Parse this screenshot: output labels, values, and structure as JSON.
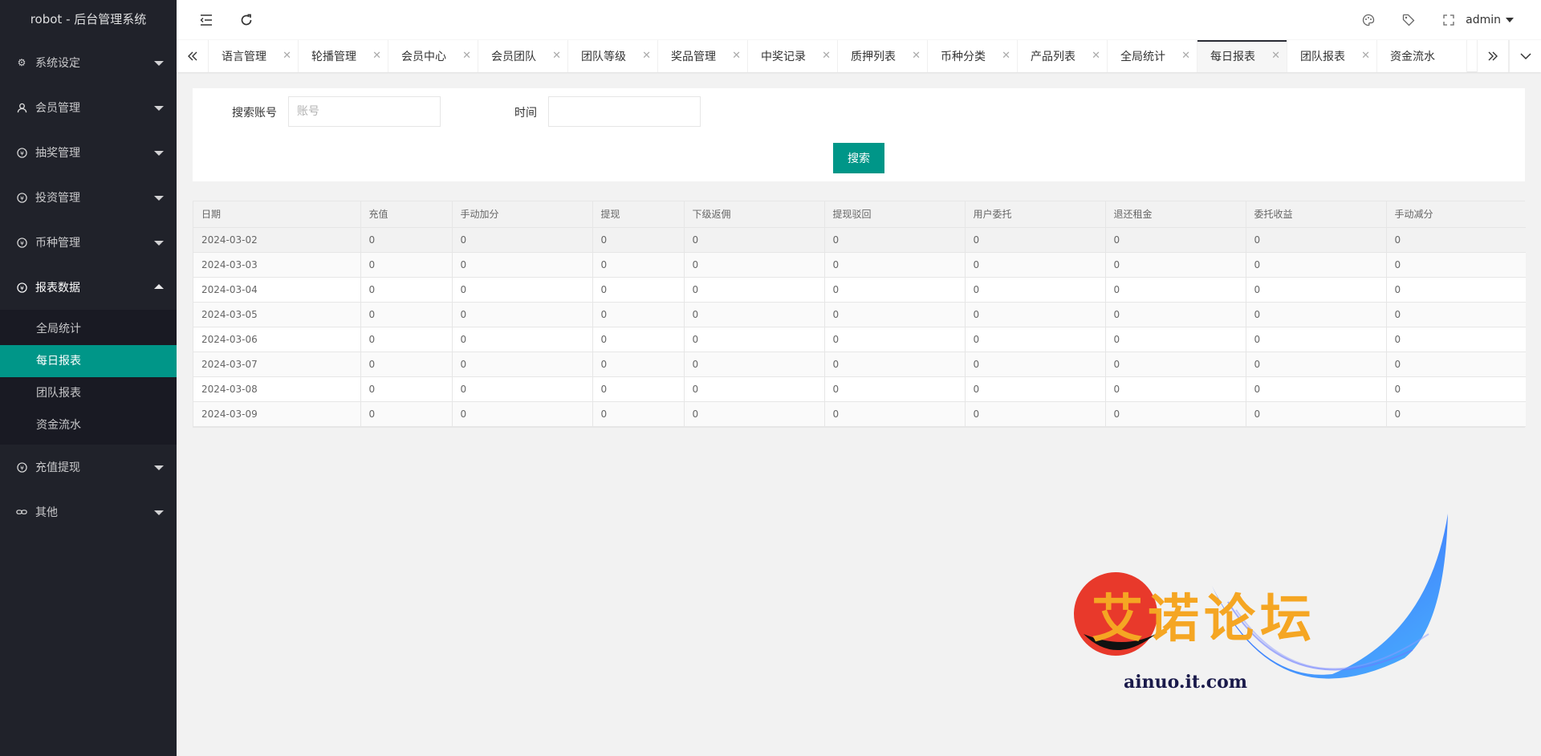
{
  "app": {
    "title": "robot - 后台管理系统"
  },
  "sidebar": {
    "items": [
      {
        "label": "系统设定",
        "icon": "gear-icon"
      },
      {
        "label": "会员管理",
        "icon": "user-icon"
      },
      {
        "label": "抽奖管理",
        "icon": "yen-icon"
      },
      {
        "label": "投资管理",
        "icon": "yen-icon"
      },
      {
        "label": "币种管理",
        "icon": "yen-icon"
      },
      {
        "label": "报表数据",
        "icon": "yen-icon"
      },
      {
        "label": "充值提现",
        "icon": "yen-icon"
      },
      {
        "label": "其他",
        "icon": "link-icon"
      }
    ],
    "report_submenu": [
      "全局统计",
      "每日报表",
      "团队报表",
      "资金流水"
    ]
  },
  "header": {
    "user": "admin"
  },
  "tabs": [
    "语言管理",
    "轮播管理",
    "会员中心",
    "会员团队",
    "团队等级",
    "奖品管理",
    "中奖记录",
    "质押列表",
    "币种分类",
    "产品列表",
    "全局统计",
    "每日报表",
    "团队报表",
    "资金流水"
  ],
  "search": {
    "account_label": "搜索账号",
    "account_placeholder": "账号",
    "account_value": "",
    "time_label": "时间",
    "time_value": "",
    "button": "搜索"
  },
  "table": {
    "columns": [
      "日期",
      "充值",
      "手动加分",
      "提现",
      "下级返佣",
      "提现驳回",
      "用户委托",
      "退还租金",
      "委托收益",
      "手动减分"
    ],
    "rows": [
      [
        "2024-03-02",
        "0",
        "0",
        "0",
        "0",
        "0",
        "0",
        "0",
        "0",
        "0"
      ],
      [
        "2024-03-03",
        "0",
        "0",
        "0",
        "0",
        "0",
        "0",
        "0",
        "0",
        "0"
      ],
      [
        "2024-03-04",
        "0",
        "0",
        "0",
        "0",
        "0",
        "0",
        "0",
        "0",
        "0"
      ],
      [
        "2024-03-05",
        "0",
        "0",
        "0",
        "0",
        "0",
        "0",
        "0",
        "0",
        "0"
      ],
      [
        "2024-03-06",
        "0",
        "0",
        "0",
        "0",
        "0",
        "0",
        "0",
        "0",
        "0"
      ],
      [
        "2024-03-07",
        "0",
        "0",
        "0",
        "0",
        "0",
        "0",
        "0",
        "0",
        "0"
      ],
      [
        "2024-03-08",
        "0",
        "0",
        "0",
        "0",
        "0",
        "0",
        "0",
        "0",
        "0"
      ],
      [
        "2024-03-09",
        "0",
        "0",
        "0",
        "0",
        "0",
        "0",
        "0",
        "0",
        "0"
      ]
    ]
  },
  "watermark": {
    "text": "艾诺论坛",
    "url": "ainuo.it.com"
  },
  "colors": {
    "sidebar": "#20222a",
    "accent": "#009688",
    "submenu": "#191a23"
  }
}
